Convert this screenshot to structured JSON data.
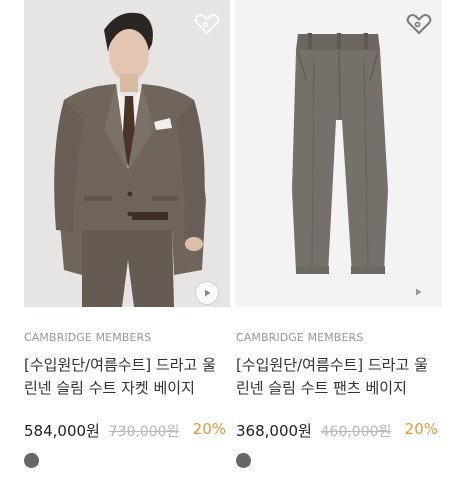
{
  "products": [
    {
      "brand": "CAMBRIDGE MEMBERS",
      "title_line1": "[수입원단/여름수트] 드라고 울",
      "title_line2": "린넨 슬림 수트 자켓 베이지",
      "price": "584,000원",
      "original_price": "730,000원",
      "discount": "20%",
      "swatch_color": "#666666",
      "wishlist_icon": "heart-tag-icon",
      "play_icon": "play-icon"
    },
    {
      "brand": "CAMBRIDGE MEMBERS",
      "title_line1": "[수입원단/여름수트] 드라고 울",
      "title_line2": "린넨 슬림 수트 팬츠 베이지",
      "price": "368,000원",
      "original_price": "460,000원",
      "discount": "20%",
      "swatch_color": "#666666",
      "wishlist_icon": "heart-tag-icon",
      "play_icon": "play-icon"
    }
  ],
  "colors": {
    "discount": "#e8963a",
    "suit": "#6f655b",
    "brand_text": "#9a9a9a"
  }
}
